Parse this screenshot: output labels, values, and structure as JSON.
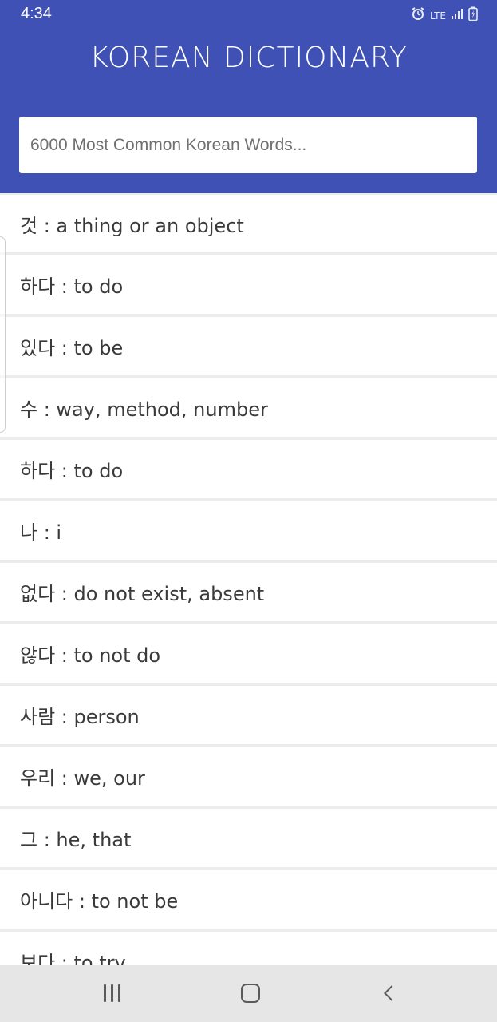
{
  "status_bar": {
    "time": "4:34",
    "network": "LTE",
    "icons": [
      "alarm-icon",
      "lte-icon",
      "signal-icon",
      "battery-icon"
    ]
  },
  "app": {
    "title": "KOREAN DICTIONARY",
    "header_color": "#3f51b5"
  },
  "search": {
    "placeholder": "6000 Most Common Korean Words..."
  },
  "words": [
    {
      "text": "것 : a thing or an object"
    },
    {
      "text": "하다 : to do"
    },
    {
      "text": "있다 : to be"
    },
    {
      "text": "수 : way, method, number"
    },
    {
      "text": "하다 : to do"
    },
    {
      "text": "나 : i"
    },
    {
      "text": "없다 : do not exist, absent"
    },
    {
      "text": "않다 : to not do"
    },
    {
      "text": "사람 : person"
    },
    {
      "text": "우리 : we, our"
    },
    {
      "text": "그 : he, that"
    },
    {
      "text": "아니다 : to not be"
    },
    {
      "text": "보다 : to try"
    }
  ],
  "nav": {
    "icons": [
      "recents-icon",
      "home-icon",
      "back-icon"
    ]
  }
}
